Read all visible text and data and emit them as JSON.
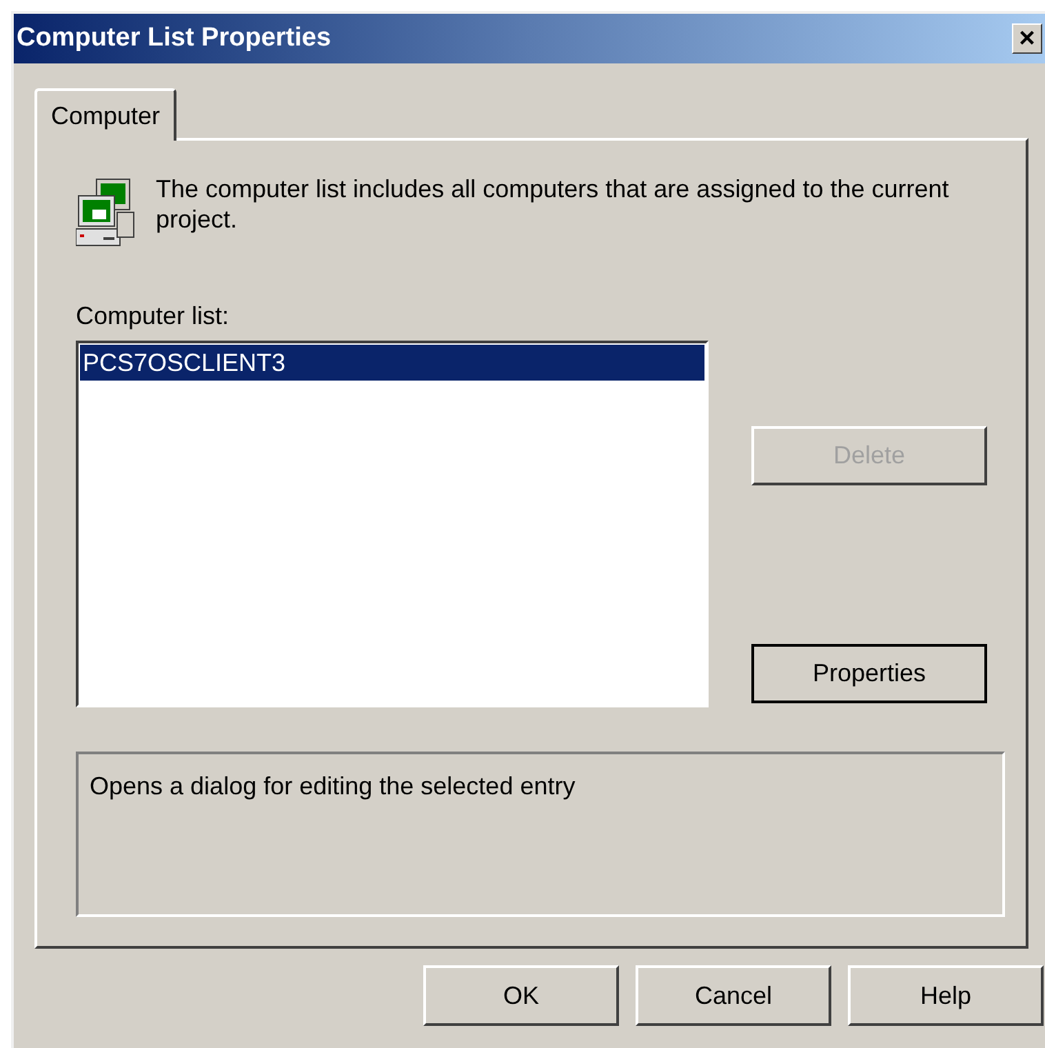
{
  "window": {
    "title": "Computer List Properties",
    "close": "×"
  },
  "tabs": [
    {
      "label": "Computer",
      "selected": true
    }
  ],
  "intro": "The computer list includes all computers that are assigned to the current project.",
  "computer_list": {
    "label": "Computer list:",
    "items": [
      {
        "label": "PCS7OSCLIENT3",
        "selected": true
      }
    ]
  },
  "side_buttons": [
    {
      "label": "Delete",
      "disabled": true,
      "default": false
    },
    {
      "label": "Properties",
      "disabled": false,
      "default": true
    }
  ],
  "hint": "Opens a dialog for editing the selected entry",
  "buttons": [
    {
      "label": "OK"
    },
    {
      "label": "Cancel"
    },
    {
      "label": "Help"
    }
  ]
}
